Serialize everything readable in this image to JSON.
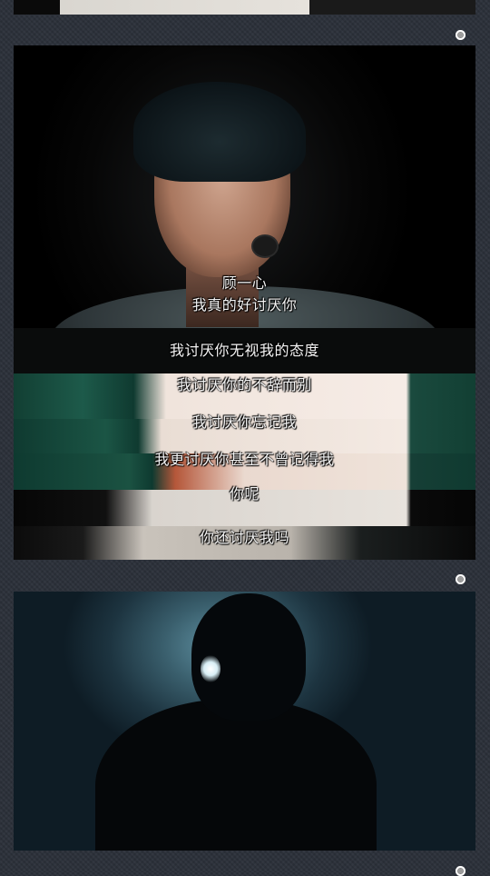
{
  "subtitles": {
    "speaker": "顾一心",
    "line1": "我真的好讨厌你",
    "line2": "我讨厌你无视我的态度",
    "line3": "我讨厌你的不辞而别",
    "line4": "我讨厌你忘记我",
    "line5": "我更讨厌你甚至不曾记得我",
    "line6": "你呢",
    "line7": "你还讨厌我吗"
  },
  "colors": {
    "background": "#2a2f38",
    "subtitle_text": "#f4f4f4",
    "indicator": "#ffffff"
  },
  "icons": [
    "radio-indicator-icon"
  ]
}
